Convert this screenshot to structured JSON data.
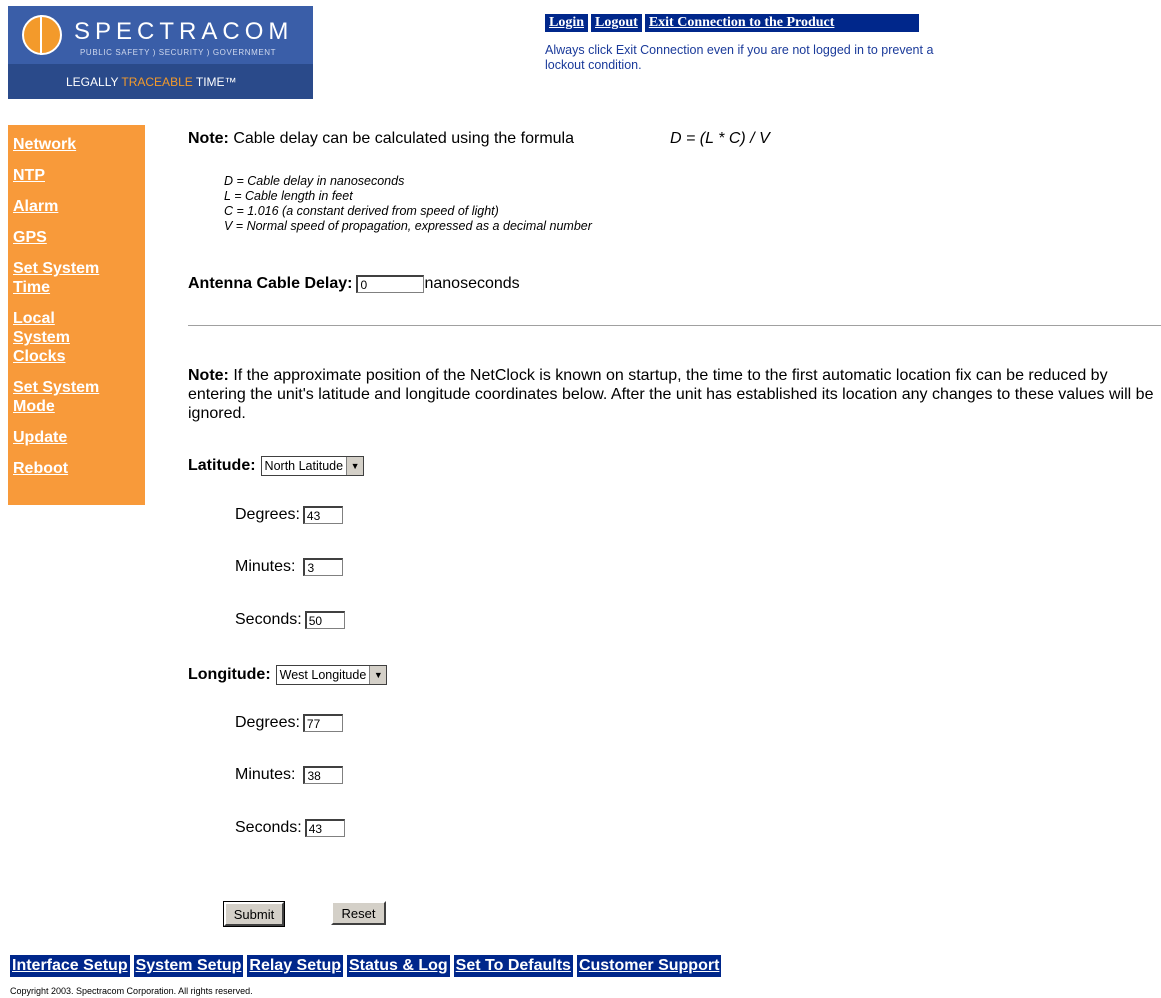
{
  "logo": {
    "brand": "SPECTRACOM",
    "sub": "PUBLIC SAFETY ) SECURITY ) GOVERNMENT",
    "tag_part1": "LEGALLY ",
    "tag_part2": "TRACEABLE",
    "tag_part3": " TIME™"
  },
  "top_links": {
    "login": "Login",
    "logout": "Logout",
    "exit": "Exit Connection to the Product",
    "note": "Always click Exit Connection even if you are not logged in to prevent a lockout condition."
  },
  "left_nav": [
    "Network",
    "NTP",
    "Alarm",
    "GPS",
    "Set System Time",
    "Local System Clocks",
    "Set System Mode",
    "Update",
    "Reboot"
  ],
  "note1": {
    "label": "Note:",
    "text": " Cable delay can be calculated using the formula",
    "formula": "D = (L * C) / V",
    "defs": [
      "D = Cable delay in nanoseconds",
      "L = Cable length in feet",
      "C = 1.016 (a constant derived from speed of light)",
      "V = Normal speed of propagation, expressed as a decimal number"
    ]
  },
  "cable_delay": {
    "label": "Antenna Cable Delay:",
    "value": "0",
    "unit": "nanoseconds"
  },
  "note2": {
    "label": "Note:",
    "text": " If the approximate position of the NetClock is known on startup, the time to the first automatic location fix can be reduced by entering the unit's latitude and longitude coordinates below. After the unit has established its location any changes to these values will be ignored."
  },
  "latitude": {
    "label": "Latitude:",
    "selected": "North Latitude",
    "degrees_label": "Degrees:",
    "degrees": "43",
    "minutes_label": "Minutes:",
    "minutes": "3",
    "seconds_label": "Seconds:",
    "seconds": "50"
  },
  "longitude": {
    "label": "Longitude:",
    "selected": "West Longitude",
    "degrees_label": "Degrees:",
    "degrees": "77",
    "minutes_label": "Minutes:",
    "minutes": "38",
    "seconds_label": "Seconds:",
    "seconds": "43"
  },
  "buttons": {
    "submit": "Submit",
    "reset": "Reset"
  },
  "bottom_nav": [
    "Interface Setup",
    "System Setup",
    "Relay Setup",
    "Status & Log",
    "Set To Defaults",
    "Customer Support"
  ],
  "copyright": "Copyright 2003. Spectracom Corporation. All rights reserved."
}
